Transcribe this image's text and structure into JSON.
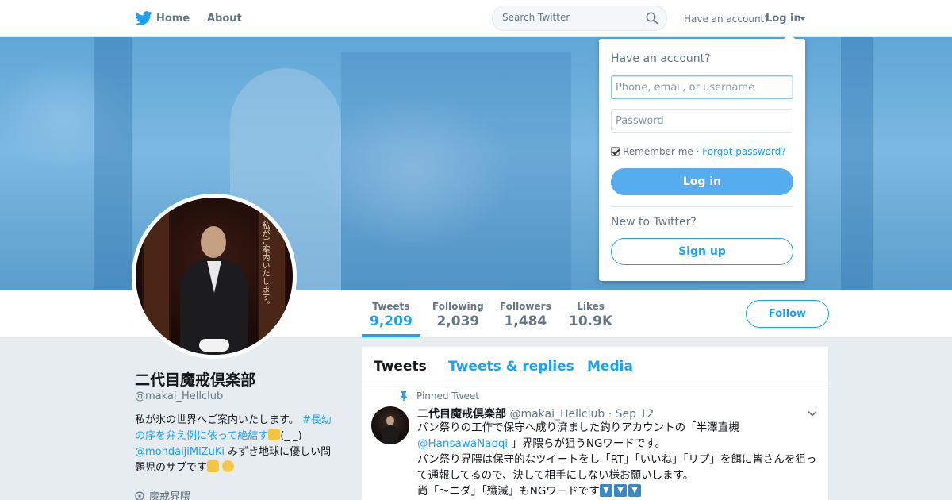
{
  "nav": {
    "logo": "twitter-bird-icon",
    "home": "Home",
    "about": "About",
    "search_placeholder": "Search Twitter",
    "have_account": "Have an account?",
    "login": "Log in"
  },
  "login_dropdown": {
    "title": "Have an account?",
    "username_placeholder": "Phone, email, or username",
    "password_placeholder": "Password",
    "remember": "Remember me",
    "separator": "·",
    "forgot": "Forgot password?",
    "remember_checked": true,
    "login_button": "Log in",
    "new_to_twitter": "New to Twitter?",
    "signup_button": "Sign up"
  },
  "avatar_text": "私がご案内いたします。",
  "stats": [
    {
      "label": "Tweets",
      "value": "9,209",
      "active": true
    },
    {
      "label": "Following",
      "value": "2,039"
    },
    {
      "label": "Followers",
      "value": "1,484"
    },
    {
      "label": "Likes",
      "value": "10.9K"
    }
  ],
  "follow_button": "Follow",
  "profile": {
    "name": "二代目魔戒倶楽部",
    "handle": "@makai_Hellclub",
    "bio_1": "私が氷の世界へご案内いたします。",
    "bio_hashtag": "#長幼の序を弁え例に依って絶結す",
    "bio_2": "(_ _)",
    "bio_mention": "@mondaijiMiZuKi",
    "bio_3": "みずき地球に優しい問題児のサブです",
    "location": "魔戒界隈"
  },
  "tabs": {
    "tweets": "Tweets",
    "replies": "Tweets & replies",
    "media": "Media"
  },
  "pinned_tweet": {
    "pinned_label": "Pinned Tweet",
    "name": "二代目魔戒倶楽部",
    "handle": "@makai_Hellclub",
    "dot": "·",
    "date": "Sep 12",
    "line1": "バン祭りの工作で保守へ成り済ました釣りアカウントの「半澤直槻",
    "mention": "@HansawaNaoqi",
    "line2": "」界隈らが狙うNGワードです。",
    "line3": "バン祭り界隈は保守的なツイートをし「RT」「いいね」「リプ」を餌に皆さんを狙って通報してるので、決して相手にしない様お願いします。",
    "line4": "尚「～ニダ」「殲滅」もNGワードです"
  },
  "colors": {
    "accent": "#1da1f2",
    "login_button": "#55acee",
    "background": "#e6ecf0"
  }
}
